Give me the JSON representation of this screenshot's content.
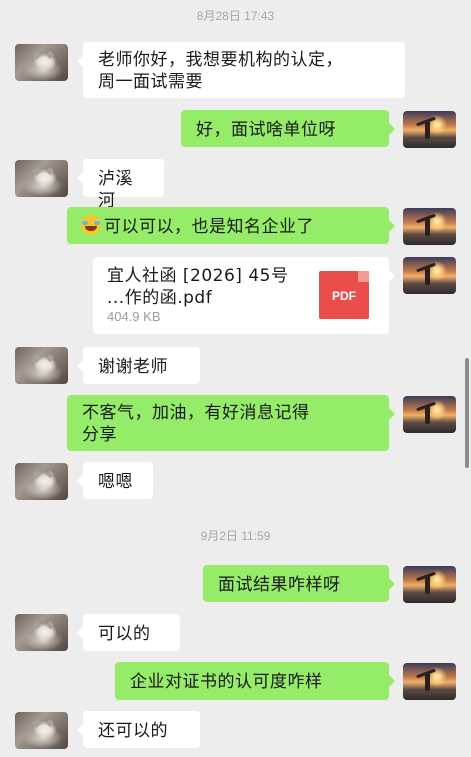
{
  "timestamps": [
    "8月28日 17:43",
    "9月2日 11:59"
  ],
  "messages": [
    {
      "side": "in",
      "text": "老师你好，我想要机构的认定，\n周一面试需要"
    },
    {
      "side": "out",
      "text": "好，面试啥单位呀"
    },
    {
      "side": "in",
      "text": "泸溪河"
    },
    {
      "side": "out",
      "text": "可以可以，也是知名企业了",
      "emoji": "grinning-sweat-emoji"
    },
    {
      "side": "in",
      "text": "谢谢老师"
    },
    {
      "side": "out",
      "text": "不客气，加油，有好消息记得\n分享"
    },
    {
      "side": "in",
      "text": "嗯嗯"
    },
    {
      "side": "out",
      "text": "面试结果咋样呀"
    },
    {
      "side": "in",
      "text": "可以的"
    },
    {
      "side": "out",
      "text": "企业对证书的认可度咋样"
    },
    {
      "side": "in",
      "text": "还可以的"
    }
  ],
  "file_message": {
    "name": "宜人社函 [2026] 45号 ...作的函.pdf",
    "size": "404.9 KB",
    "icon_label": "PDF"
  },
  "avatars": {
    "contact": "cat-avatar",
    "self": "sunset-avatar"
  },
  "colors": {
    "background": "#ededed",
    "outgoing_bubble": "#95ec69",
    "incoming_bubble": "#ffffff",
    "pdf_icon": "#e94e4a"
  }
}
